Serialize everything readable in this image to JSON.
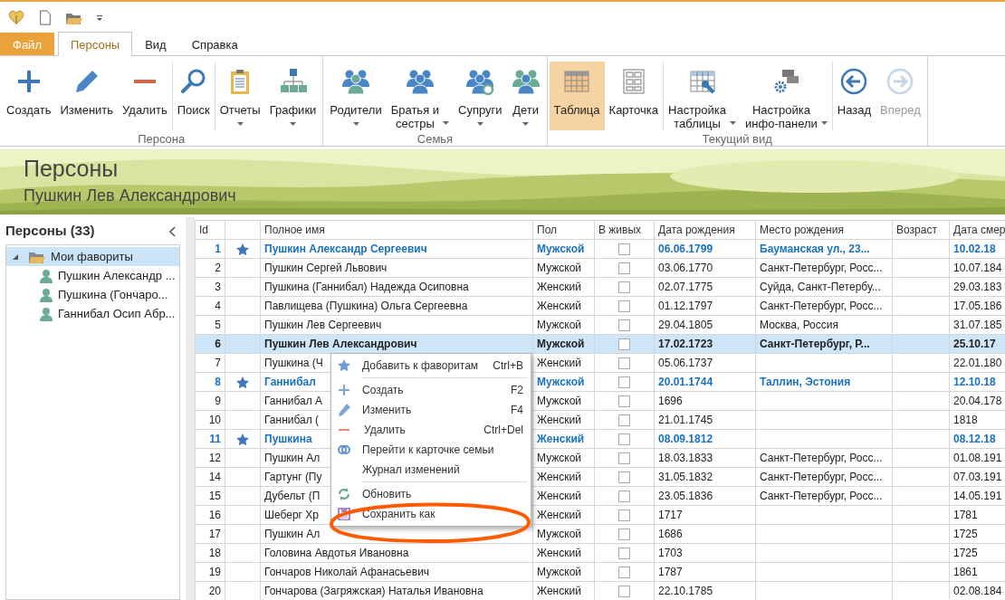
{
  "ribbon": {
    "tabs": [
      {
        "label": "Файл",
        "kind": "file",
        "selected": false
      },
      {
        "label": "Персоны",
        "kind": "tab",
        "selected": true
      },
      {
        "label": "Вид",
        "kind": "tab",
        "selected": false
      },
      {
        "label": "Справка",
        "kind": "tab",
        "selected": false
      }
    ],
    "groups": [
      {
        "label": "Персона",
        "clusters": [
          [
            {
              "label": "Создать",
              "dropdown": false,
              "selected": false,
              "disabled": false
            },
            {
              "label": "Изменить",
              "dropdown": false,
              "selected": false,
              "disabled": false
            },
            {
              "label": "Удалить",
              "dropdown": false,
              "selected": false,
              "disabled": false
            }
          ],
          [
            {
              "label": "Поиск",
              "dropdown": false,
              "selected": false,
              "disabled": false
            }
          ],
          [
            {
              "label": "Отчеты",
              "dropdown": true,
              "selected": false,
              "disabled": false
            },
            {
              "label": "Графики",
              "dropdown": true,
              "selected": false,
              "disabled": false
            }
          ]
        ]
      },
      {
        "label": "Семья",
        "clusters": [
          [
            {
              "label": "Родители",
              "dropdown": true,
              "selected": false,
              "disabled": false
            },
            {
              "label": "Братья и\nсестры",
              "dropdown": true,
              "selected": false,
              "disabled": false
            },
            {
              "label": "Супруги",
              "dropdown": true,
              "selected": false,
              "disabled": false
            },
            {
              "label": "Дети",
              "dropdown": true,
              "selected": false,
              "disabled": false
            }
          ]
        ]
      },
      {
        "label": "Текущий вид",
        "clusters": [
          [
            {
              "label": "Таблица",
              "dropdown": false,
              "selected": true,
              "disabled": false
            },
            {
              "label": "Карточка",
              "dropdown": false,
              "selected": false,
              "disabled": false
            }
          ],
          [
            {
              "label": "Настройка\nтаблицы",
              "dropdown": true,
              "selected": false,
              "disabled": false
            },
            {
              "label": "Настройка\nинфо-панели",
              "dropdown": true,
              "selected": false,
              "disabled": false
            }
          ],
          [
            {
              "label": "Назад",
              "dropdown": false,
              "selected": false,
              "disabled": false
            },
            {
              "label": "Вперед",
              "dropdown": false,
              "selected": false,
              "disabled": true
            }
          ]
        ]
      }
    ]
  },
  "banner": {
    "title": "Персоны",
    "subtitle": "Пушкин Лев Александрович"
  },
  "sidebar": {
    "title": "Персоны (33)",
    "tree": [
      {
        "label": "Мои фавориты",
        "expanded": true,
        "selected": true,
        "children": [
          {
            "label": "Пушкин Александр ...",
            "selected": false
          },
          {
            "label": "Пушкина (Гончаро...",
            "selected": false
          },
          {
            "label": "Ганнибал Осип Абр...",
            "selected": false
          }
        ]
      }
    ]
  },
  "table": {
    "columns": [
      "Id",
      "Полное имя",
      "Пол",
      "В живых",
      "Дата рождения",
      "Место рождения",
      "Возраст",
      "Дата смер"
    ],
    "rows": [
      {
        "id": "1",
        "favorite": true,
        "selected": false,
        "name": "Пушкин Александр Сергеевич",
        "gender": "Мужской",
        "alive": false,
        "birth": "06.06.1799",
        "place": "Бауманская ул., 23...",
        "death": "10.02.18"
      },
      {
        "id": "2",
        "favorite": false,
        "selected": false,
        "name": "Пушкин Сергей Львович",
        "gender": "Мужской",
        "alive": false,
        "birth": "03.06.1770",
        "place": "Санкт-Петербург, Росс...",
        "death": "10.07.184"
      },
      {
        "id": "3",
        "favorite": false,
        "selected": false,
        "name": "Пушкина (Ганнибал) Надежда Осиповна",
        "gender": "Женский",
        "alive": false,
        "birth": "02.07.1775",
        "place": "Суйда, Санкт-Петербу...",
        "death": "29.03.183"
      },
      {
        "id": "4",
        "favorite": false,
        "selected": false,
        "name": "Павлищева (Пушкина) Ольга Сергеевна",
        "gender": "Женский",
        "alive": false,
        "birth": "01.12.1797",
        "place": "Санкт-Петербург, Росс...",
        "death": "17.05.186"
      },
      {
        "id": "5",
        "favorite": false,
        "selected": false,
        "name": "Пушкин Лев Сергеевич",
        "gender": "Мужской",
        "alive": false,
        "birth": "29.04.1805",
        "place": "Москва, Россия",
        "death": "31.07.185"
      },
      {
        "id": "6",
        "favorite": false,
        "selected": true,
        "name": "Пушкин Лев Александрович",
        "gender": "Мужской",
        "alive": false,
        "birth": "17.02.1723",
        "place": "Санкт-Петербург, Р...",
        "death": "25.10.17"
      },
      {
        "id": "7",
        "favorite": false,
        "selected": false,
        "name": "Пушкина (Ч",
        "gender": "Женский",
        "alive": false,
        "birth": "05.06.1737",
        "death": "22.01.180"
      },
      {
        "id": "8",
        "favorite": true,
        "selected": false,
        "name": "Ганнибал",
        "gender": "Мужской",
        "alive": false,
        "birth": "20.01.1744",
        "place": "Таллин, Эстония",
        "death": "12.10.18"
      },
      {
        "id": "9",
        "favorite": false,
        "selected": false,
        "name": "Ганнибал А",
        "gender": "Мужской",
        "alive": false,
        "birth": "1696",
        "death": "20.04.178"
      },
      {
        "id": "10",
        "favorite": false,
        "selected": false,
        "name": "Ганнибал (",
        "gender": "Женский",
        "alive": false,
        "birth": "21.01.1745",
        "death": "1818"
      },
      {
        "id": "11",
        "favorite": true,
        "selected": false,
        "name": "Пушкина",
        "gender": "Женский",
        "alive": false,
        "birth": "08.09.1812",
        "death": "08.12.18"
      },
      {
        "id": "12",
        "favorite": false,
        "selected": false,
        "name": "Пушкин Ал",
        "gender": "Мужской",
        "alive": false,
        "birth": "18.03.1833",
        "place": "Санкт-Петербург, Росс...",
        "death": "01.08.191"
      },
      {
        "id": "14",
        "favorite": false,
        "selected": false,
        "name": "Гартунг (Пу",
        "gender": "Женский",
        "alive": false,
        "birth": "31.05.1832",
        "place": "Санкт-Петербург, Росс...",
        "death": "07.03.191"
      },
      {
        "id": "15",
        "favorite": false,
        "selected": false,
        "name": "Дубельт (П",
        "gender": "Женский",
        "alive": false,
        "birth": "23.05.1836",
        "place": "Санкт-Петербург, Росс...",
        "death": "14.05.191"
      },
      {
        "id": "16",
        "favorite": false,
        "selected": false,
        "name": "Шеберг Хр",
        "gender": "Женский",
        "alive": false,
        "birth": "1717",
        "death": "1781"
      },
      {
        "id": "17",
        "favorite": false,
        "selected": false,
        "name": "Пушкин Ал",
        "gender": "Мужской",
        "alive": false,
        "birth": "1686",
        "death": "1725"
      },
      {
        "id": "18",
        "favorite": false,
        "selected": false,
        "name": "Головина Авдотья Ивановна",
        "gender": "Женский",
        "alive": false,
        "birth": "1703",
        "death": "1725"
      },
      {
        "id": "19",
        "favorite": false,
        "selected": false,
        "name": "Гончаров Николай Афанасьевич",
        "gender": "Мужской",
        "alive": false,
        "birth": "1787",
        "death": "1861"
      },
      {
        "id": "20",
        "favorite": false,
        "selected": false,
        "name": "Гончарова (Загряжская) Наталья Ивановна",
        "gender": "Женский",
        "alive": false,
        "birth": "22.10.1785",
        "death": "02.08.184"
      }
    ]
  },
  "context_menu": {
    "sections": [
      [
        {
          "label": "Добавить к фаворитам",
          "shortcut": "Ctrl+B"
        }
      ],
      [
        {
          "label": "Создать",
          "shortcut": "F2"
        },
        {
          "label": "Изменить",
          "shortcut": "F4"
        },
        {
          "label": "Удалить",
          "shortcut": "Ctrl+Del"
        },
        {
          "label": "Перейти к карточке семьи"
        },
        {
          "label": "Журнал изменений"
        }
      ],
      [
        {
          "label": "Обновить"
        },
        {
          "label": "Сохранить как"
        }
      ]
    ]
  }
}
